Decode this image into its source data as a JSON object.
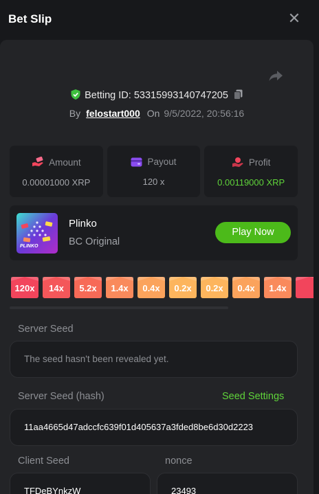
{
  "header": {
    "title": "Bet Slip",
    "close_glyph": "✕"
  },
  "bet": {
    "id_label": "Betting ID:",
    "id_value": "53315993140747205",
    "by_label": "By",
    "user": "felostart000",
    "on_label": "On",
    "date": "9/5/2022, 20:56:16"
  },
  "stats": [
    {
      "label": "Amount",
      "value": "0.00001000 XRP",
      "icon": "money-hand-icon"
    },
    {
      "label": "Payout",
      "value": "120 x",
      "icon": "wallet-card-icon"
    },
    {
      "label": "Profit",
      "value": "0.00119000 XRP",
      "icon": "profit-hand-icon"
    }
  ],
  "game": {
    "name": "Plinko",
    "provider": "BC Original",
    "play_label": "Play Now",
    "thumb_text": "PLINKO"
  },
  "multipliers": [
    {
      "label": "120x",
      "color": "#f2455c"
    },
    {
      "label": "14x",
      "color": "#f4575a"
    },
    {
      "label": "5.2x",
      "color": "#f76a57"
    },
    {
      "label": "1.4x",
      "color": "#f98a5c"
    },
    {
      "label": "0.4x",
      "color": "#fba35c"
    },
    {
      "label": "0.2x",
      "color": "#fdb55d"
    },
    {
      "label": "0.2x",
      "color": "#fdb55d"
    },
    {
      "label": "0.4x",
      "color": "#fba35c"
    },
    {
      "label": "1.4x",
      "color": "#f98a5c"
    }
  ],
  "seeds": {
    "server_seed_label": "Server Seed",
    "server_seed_value": "The seed hasn't been revealed yet.",
    "server_hash_label": "Server Seed (hash)",
    "seed_settings_label": "Seed Settings",
    "server_hash_value": "11aa4665d47adccfc639f01d405637a3fded8be6d30d2223",
    "client_seed_label": "Client Seed",
    "client_seed_value": "TFDeBYnkzW",
    "nonce_label": "nonce",
    "nonce_value": "23493"
  },
  "colors": {
    "accent_green": "#4cba1a",
    "profit_green": "#5fd33a",
    "background": "#17181b",
    "panel": "#232427"
  }
}
